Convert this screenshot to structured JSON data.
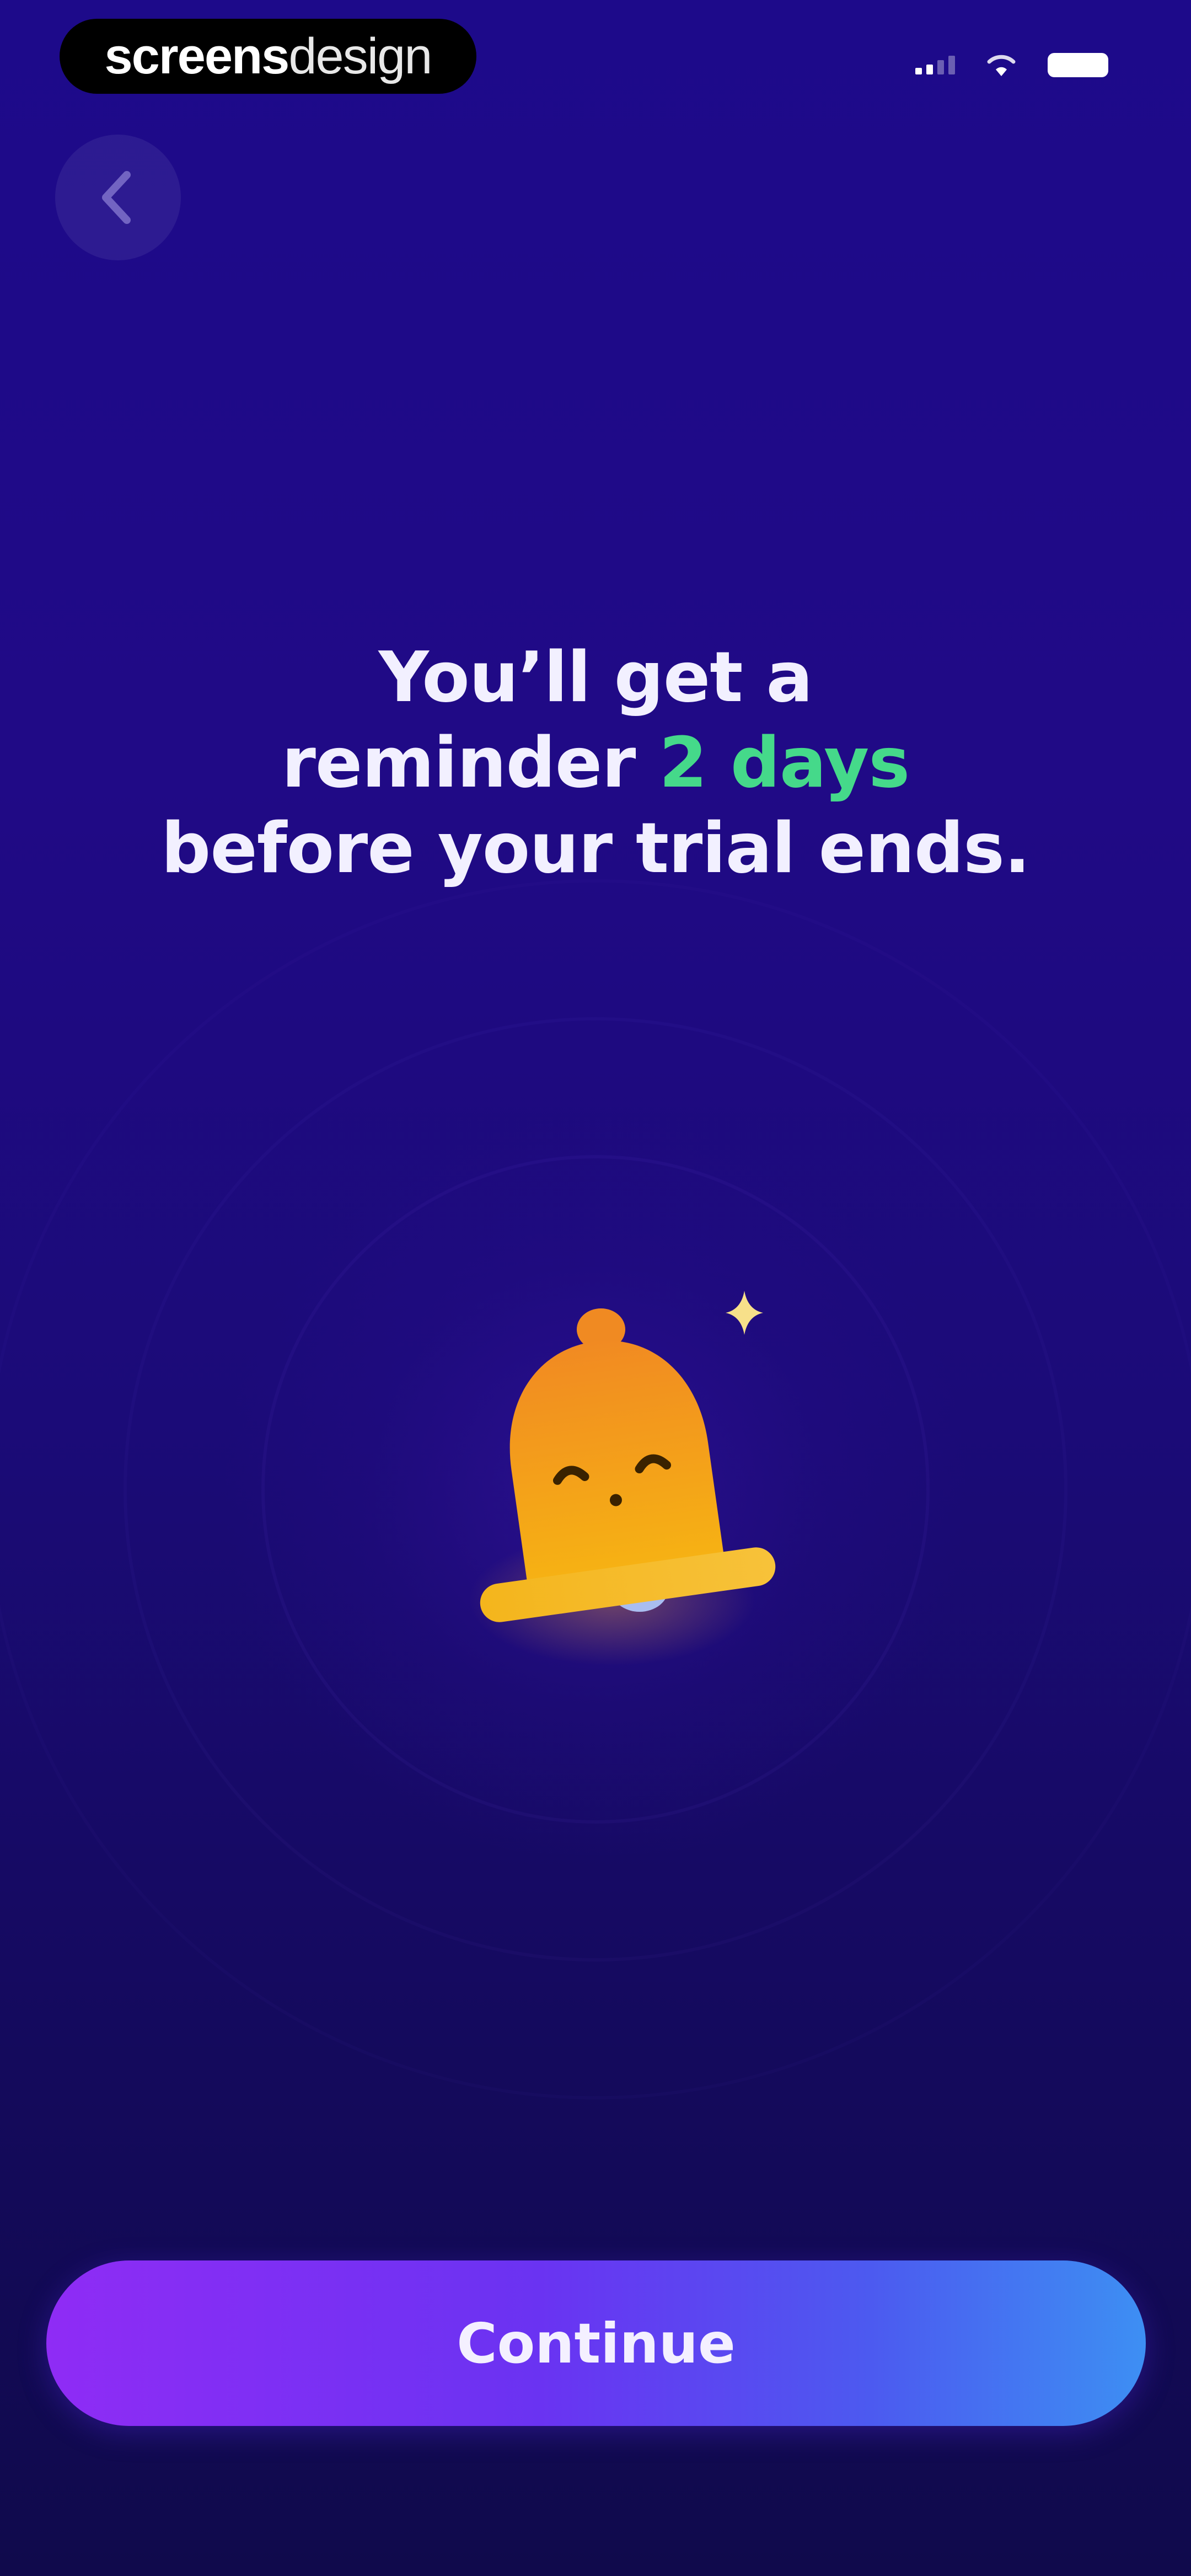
{
  "status_bar": {
    "brand_part1": "screens",
    "brand_part2": "design",
    "icons": [
      "signal-icon",
      "wifi-icon",
      "battery-icon"
    ]
  },
  "nav": {
    "back_icon": "chevron-left-icon"
  },
  "headline": {
    "line1": "You’ll get a",
    "line2_prefix": "reminder ",
    "line2_accent": "2 days",
    "line3": "before your trial ends."
  },
  "illustration": {
    "icon": "bell-icon",
    "sparkle": "sparkle-icon"
  },
  "primary_action": {
    "label": "Continue"
  },
  "colors": {
    "background_top": "#1d0a8a",
    "background_bottom": "#100a4c",
    "accent_green": "#45d98a",
    "bell_orange": "#f4a017",
    "button_gradient_start": "#8f2cf5",
    "button_gradient_end": "#3d8ff3"
  }
}
